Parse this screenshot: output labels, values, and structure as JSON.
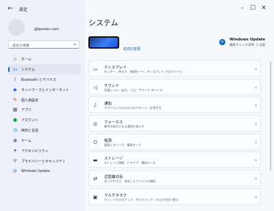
{
  "window": {
    "title": "設定",
    "back_glyph": "←",
    "min_glyph": "–",
    "max_glyph": "☐",
    "close_glyph": "✕"
  },
  "account": {
    "email": "@ipentec.com"
  },
  "search": {
    "placeholder": "設定の検索",
    "icon": "search-icon"
  },
  "sidebar": {
    "items": [
      {
        "label": "ホーム",
        "icon": "home-icon",
        "glyph": "⌂",
        "color": "#d97706"
      },
      {
        "label": "システム",
        "icon": "monitor-icon",
        "glyph": "▭",
        "color": "#0067c0",
        "active": true
      },
      {
        "label": "Bluetooth とデバイス",
        "icon": "bluetooth-icon",
        "glyph": "ᛒ",
        "color": "#0078d4"
      },
      {
        "label": "ネットワークとインターネット",
        "icon": "wifi-icon",
        "glyph": "◆",
        "color": "#2563eb"
      },
      {
        "label": "個人用設定",
        "icon": "brush-icon",
        "glyph": "✎",
        "color": "#c2410c"
      },
      {
        "label": "アプリ",
        "icon": "apps-icon",
        "glyph": "▦",
        "color": "#4b5563"
      },
      {
        "label": "アカウント",
        "icon": "account-icon",
        "glyph": "●",
        "color": "#16a34a"
      },
      {
        "label": "時刻と言語",
        "icon": "clock-globe-icon",
        "glyph": "◷",
        "color": "#0284c7"
      },
      {
        "label": "ゲーム",
        "icon": "gamepad-icon",
        "glyph": "◉",
        "color": "#6b7280"
      },
      {
        "label": "アクセシビリティ",
        "icon": "accessibility-icon",
        "glyph": "✦",
        "color": "#1d4ed8"
      },
      {
        "label": "プライバシーとセキュリティ",
        "icon": "shield-icon",
        "glyph": "⛨",
        "color": "#6b7280"
      },
      {
        "label": "Windows Update",
        "icon": "update-icon",
        "glyph": "⟳",
        "color": "#0067c0"
      }
    ]
  },
  "main": {
    "title": "システム",
    "rename_link": "名前の変更",
    "windows_update": {
      "title": "Windows Update",
      "subtitle": "最終チェック日時: 1 分前",
      "glyph": "⟳"
    },
    "cards": [
      {
        "title": "ディスプレイ",
        "desc": "モニター、明るさ、夜間モード、ディスプレイ プロファイル",
        "icon": "display-icon",
        "glyph": "▭"
      },
      {
        "title": "サウンド",
        "desc": "音量レベル、出力、入力、サウンド デバイス",
        "icon": "speaker-icon",
        "glyph": "◁"
      },
      {
        "title": "通知",
        "desc": "アプリとシステムからのアラート、応答不可",
        "icon": "bell-icon",
        "glyph": "♪"
      },
      {
        "title": "フォーカス",
        "desc": "集中の妨げになる通知を減らす",
        "icon": "focus-icon",
        "glyph": "◎"
      },
      {
        "title": "電源",
        "desc": "画面とスリープ、電源モード",
        "icon": "power-icon",
        "glyph": "⏻"
      },
      {
        "title": "ストレージ",
        "desc": "ストレージ領域、ドライブ、構成ルール",
        "icon": "storage-icon",
        "glyph": "▬"
      },
      {
        "title": "近距離共有",
        "desc": "見つけやすさ、受信したファイルの場所",
        "icon": "share-icon",
        "glyph": "⇄"
      },
      {
        "title": "マルチタスク",
        "desc": "ウィンドウのスナップ、デスクトップ、タスクの切り替え",
        "icon": "multitask-icon",
        "glyph": "▣"
      }
    ],
    "chevron": "›"
  }
}
